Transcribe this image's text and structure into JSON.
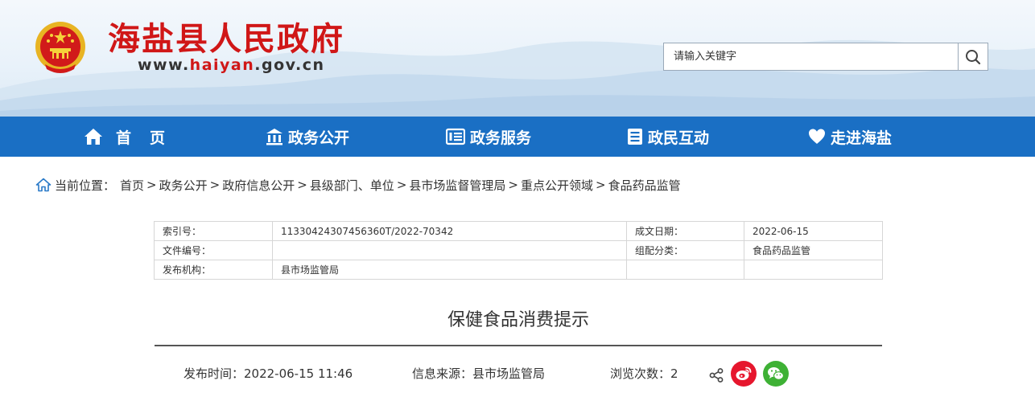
{
  "header": {
    "site_name": "海盐县人民政府",
    "url_prefix": "www.",
    "url_highlight": "haiyan",
    "url_suffix": ".gov.cn",
    "search_placeholder": "请输入关键字"
  },
  "nav": {
    "items": [
      {
        "label": "首　页",
        "icon": "home-icon"
      },
      {
        "label": "政务公开",
        "icon": "government-building-icon"
      },
      {
        "label": "政务服务",
        "icon": "service-list-icon"
      },
      {
        "label": "政民互动",
        "icon": "document-icon"
      },
      {
        "label": "走进海盐",
        "icon": "heart-icon"
      }
    ]
  },
  "breadcrumb": {
    "label": "当前位置：",
    "items": [
      "首页",
      "政务公开",
      "政府信息公开",
      "县级部门、单位",
      "县市场监督管理局",
      "重点公开领域",
      "食品药品监管"
    ]
  },
  "info_table": {
    "rows": [
      [
        "索引号：",
        "11330424307456360T/2022-70342",
        "成文日期：",
        "2022-06-15"
      ],
      [
        "文件编号：",
        "",
        "组配分类：",
        "食品药品监管"
      ],
      [
        "发布机构：",
        "县市场监管局",
        "",
        ""
      ]
    ]
  },
  "article": {
    "title": "保健食品消费提示",
    "publish_time": "发布时间：2022-06-15 11:46",
    "source": "信息来源：县市场监管局",
    "views": "浏览次数：2"
  },
  "colors": {
    "brand_red": "#d01717",
    "nav_blue": "#1a6fc4",
    "weibo_red": "#e6162d",
    "wechat_green": "#3eb135"
  }
}
